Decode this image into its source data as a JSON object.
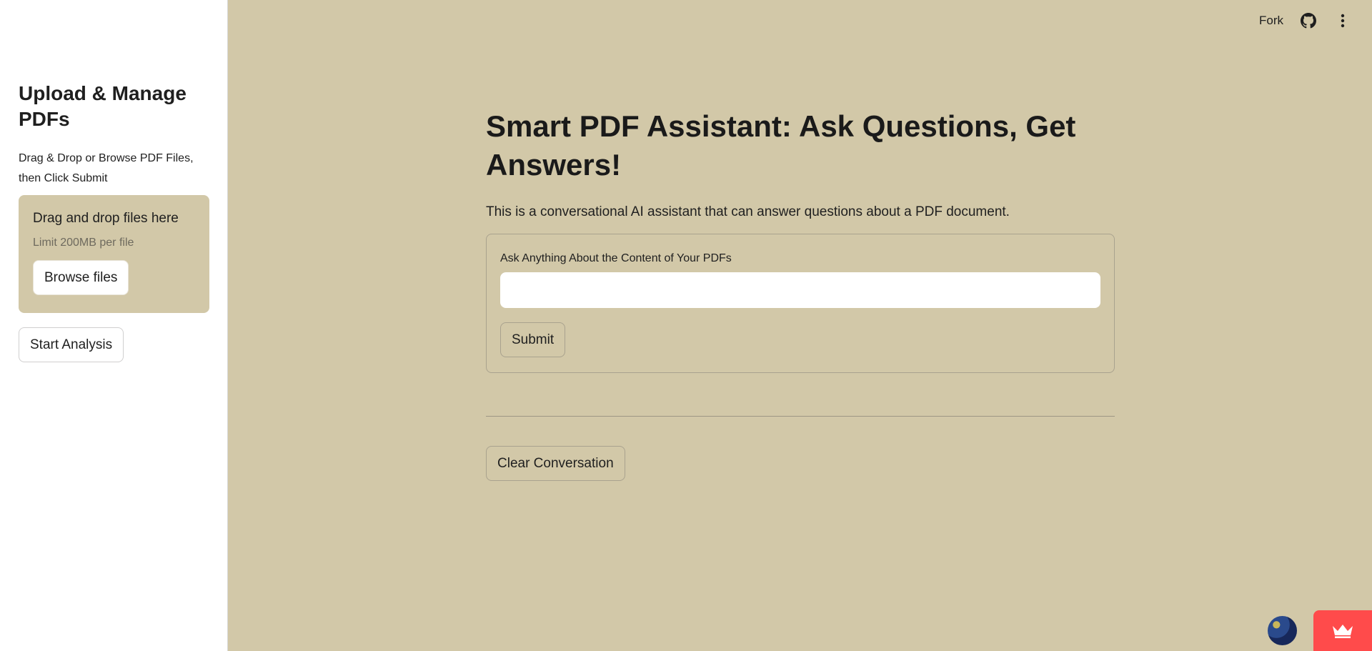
{
  "sidebar": {
    "title": "Upload & Manage PDFs",
    "description": "Drag & Drop or Browse PDF Files, then Click Submit",
    "dropzone": {
      "title": "Drag and drop files here",
      "limit": "Limit 200MB per file",
      "browse_label": "Browse files"
    },
    "start_label": "Start Analysis"
  },
  "topbar": {
    "fork_label": "Fork",
    "github_icon": "github-icon",
    "menu_icon": "kebab-menu-icon"
  },
  "main": {
    "title": "Smart PDF Assistant: Ask Questions, Get Answers!",
    "description": "This is a conversational AI assistant that can answer questions about a PDF document.",
    "form": {
      "label": "Ask Anything About the Content of Your PDFs",
      "input_value": "",
      "submit_label": "Submit"
    },
    "clear_label": "Clear Conversation"
  },
  "colors": {
    "main_background": "#d2c8a8",
    "sidebar_background": "#ffffff",
    "badge": "#ff4b4b"
  }
}
